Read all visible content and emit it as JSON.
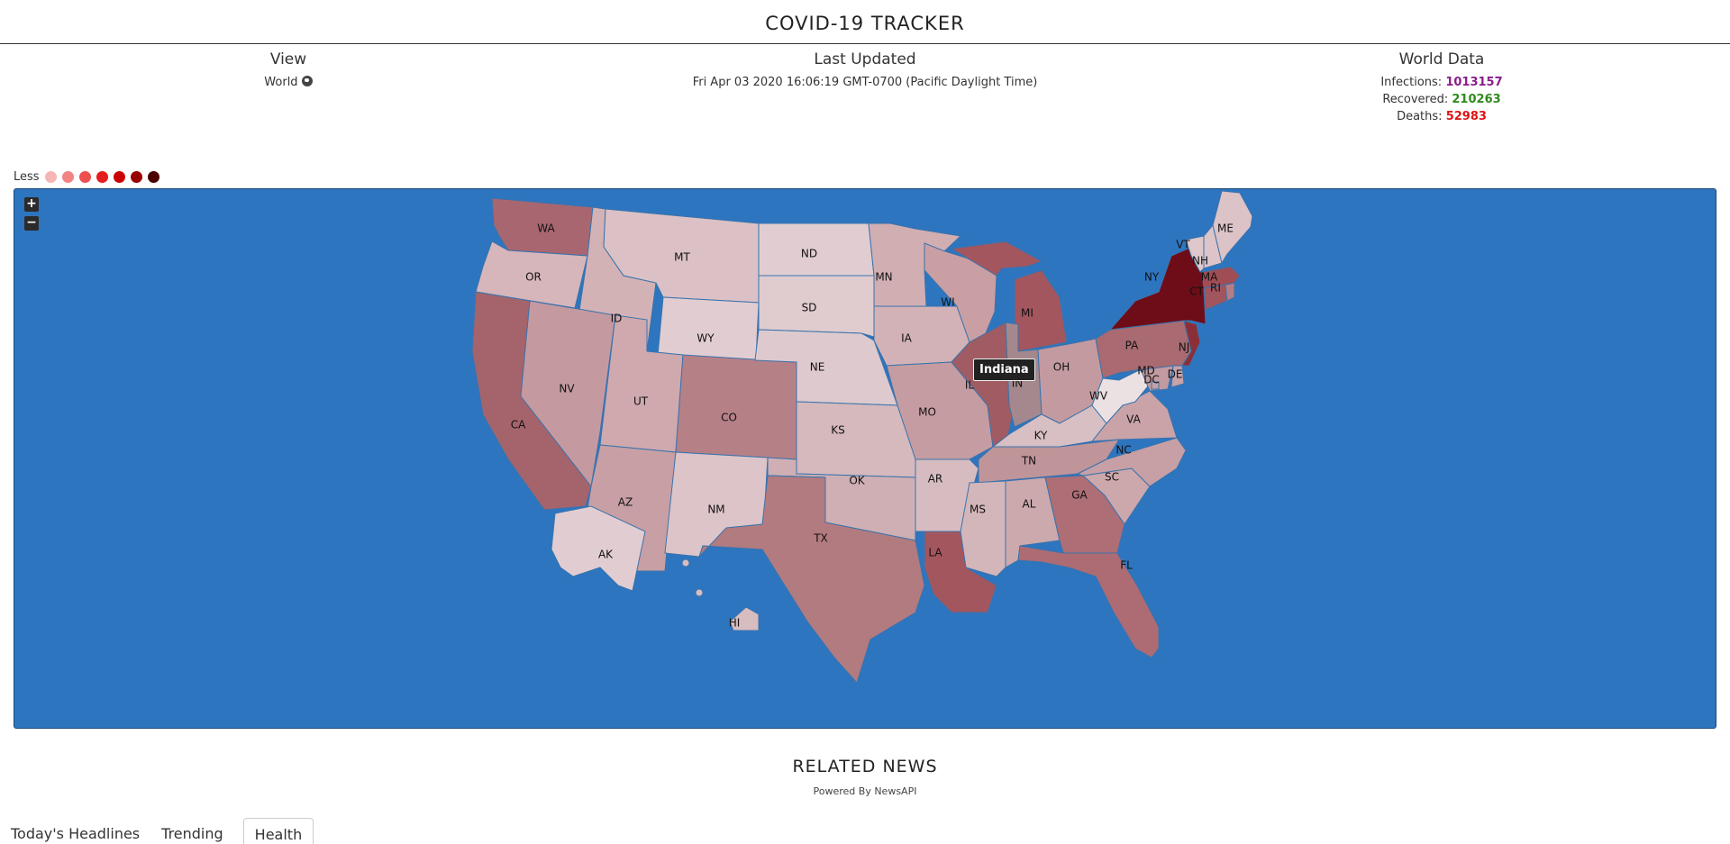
{
  "header": {
    "title": "COVID-19 TRACKER"
  },
  "view": {
    "label": "View",
    "value": "World"
  },
  "updated": {
    "label": "Last Updated",
    "value": "Fri Apr 03 2020 16:06:19 GMT-0700 (Pacific Daylight Time)"
  },
  "world": {
    "label": "World Data",
    "infections_label": "Infections:",
    "infections": "1013157",
    "recovered_label": "Recovered:",
    "recovered": "210263",
    "deaths_label": "Deaths:",
    "deaths": "52983"
  },
  "legend": {
    "label": "Less",
    "colors": [
      "#f6b6b6",
      "#f28383",
      "#ee4f4f",
      "#e61c1c",
      "#cc0000",
      "#990000",
      "#4d0000"
    ]
  },
  "map": {
    "zoom_in": "+",
    "zoom_out": "−",
    "water_color": "#2e75bf",
    "tooltip": "Indiana",
    "states": [
      {
        "code": "WA",
        "color": "#a86670"
      },
      {
        "code": "OR",
        "color": "#d7b6bb"
      },
      {
        "code": "CA",
        "color": "#a5646b"
      },
      {
        "code": "ID",
        "color": "#d3b2b6"
      },
      {
        "code": "NV",
        "color": "#c49aa0"
      },
      {
        "code": "MT",
        "color": "#dbc1c5"
      },
      {
        "code": "WY",
        "color": "#e1cdd1"
      },
      {
        "code": "UT",
        "color": "#cfa9ae"
      },
      {
        "code": "AZ",
        "color": "#c79fa4"
      },
      {
        "code": "CO",
        "color": "#b68087"
      },
      {
        "code": "NM",
        "color": "#dcc4c8"
      },
      {
        "code": "ND",
        "color": "#e1cdd1"
      },
      {
        "code": "SD",
        "color": "#e0cbcf"
      },
      {
        "code": "NE",
        "color": "#decaced"
      },
      {
        "code": "KS",
        "color": "#d5b9bd"
      },
      {
        "code": "OK",
        "color": "#cfafb3"
      },
      {
        "code": "TX",
        "color": "#b27b80"
      },
      {
        "code": "MN",
        "color": "#d1aeb2"
      },
      {
        "code": "IA",
        "color": "#d2b2b6"
      },
      {
        "code": "MO",
        "color": "#c59ca1"
      },
      {
        "code": "AR",
        "color": "#d6bcc0"
      },
      {
        "code": "LA",
        "color": "#a4565e"
      },
      {
        "code": "WI",
        "color": "#c99fa4"
      },
      {
        "code": "IL",
        "color": "#a05c62"
      },
      {
        "code": "MI",
        "color": "#a4565e"
      },
      {
        "code": "IN",
        "color": "#a4888d"
      },
      {
        "code": "OH",
        "color": "#c39aa0"
      },
      {
        "code": "KY",
        "color": "#d8bfc3"
      },
      {
        "code": "TN",
        "color": "#c0959a"
      },
      {
        "code": "MS",
        "color": "#d3b6ba"
      },
      {
        "code": "AL",
        "color": "#cba9ad"
      },
      {
        "code": "GA",
        "color": "#ad6e75"
      },
      {
        "code": "FL",
        "color": "#ad6c73"
      },
      {
        "code": "SC",
        "color": "#cca7ab"
      },
      {
        "code": "NC",
        "color": "#c7a0a5"
      },
      {
        "code": "VA",
        "color": "#c9a3a8"
      },
      {
        "code": "WV",
        "color": "#ebe0e2"
      },
      {
        "code": "PA",
        "color": "#a96a71"
      },
      {
        "code": "NY",
        "color": "#6e0d18"
      },
      {
        "code": "NJ",
        "color": "#8c2e38"
      },
      {
        "code": "MD",
        "color": "#c29aa0"
      },
      {
        "code": "DE",
        "color": "#c7a2a7"
      },
      {
        "code": "DC",
        "color": "#c5a0a5"
      },
      {
        "code": "CT",
        "color": "#a2555d"
      },
      {
        "code": "RI",
        "color": "#b67d84"
      },
      {
        "code": "MA",
        "color": "#a04d56"
      },
      {
        "code": "VT",
        "color": "#dfc8cc"
      },
      {
        "code": "NH",
        "color": "#dcc4c8"
      },
      {
        "code": "ME",
        "color": "#dcc3c7"
      },
      {
        "code": "AK",
        "color": "#e1cdd1"
      },
      {
        "code": "HI",
        "color": "#d7bcc0"
      }
    ]
  },
  "news": {
    "title": "RELATED NEWS",
    "subtitle": "Powered By NewsAPI",
    "tabs": [
      "Today's Headlines",
      "Trending",
      "Health"
    ]
  }
}
